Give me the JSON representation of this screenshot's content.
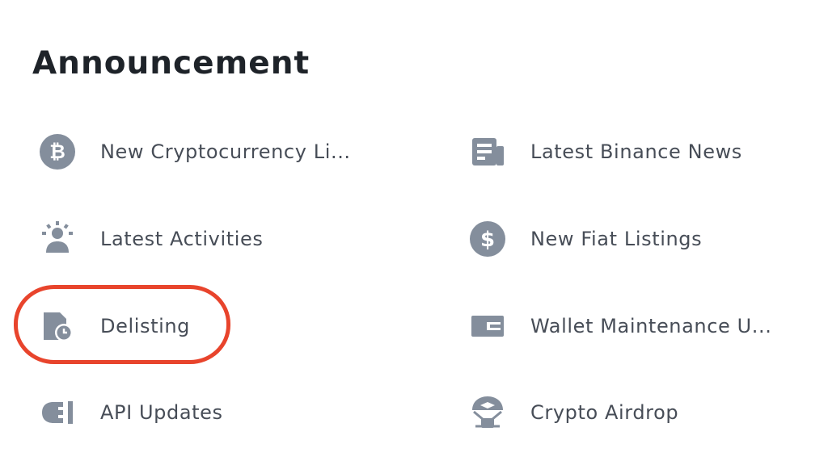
{
  "title": "Announcement",
  "colors": {
    "icon": "#848e9c",
    "text": "#474d57",
    "title": "#1e2329",
    "highlight": "#e8442c"
  },
  "items": [
    {
      "label": "New Cryptocurrency Li...",
      "icon": "bitcoin-icon"
    },
    {
      "label": "Latest Binance News",
      "icon": "news-icon"
    },
    {
      "label": "Latest Activities",
      "icon": "people-icon"
    },
    {
      "label": "New Fiat Listings",
      "icon": "dollar-icon"
    },
    {
      "label": "Delisting",
      "icon": "delisting-clock-icon"
    },
    {
      "label": "Wallet Maintenance U...",
      "icon": "wallet-icon"
    },
    {
      "label": "API Updates",
      "icon": "plug-icon"
    },
    {
      "label": "Crypto Airdrop",
      "icon": "airdrop-icon"
    }
  ]
}
